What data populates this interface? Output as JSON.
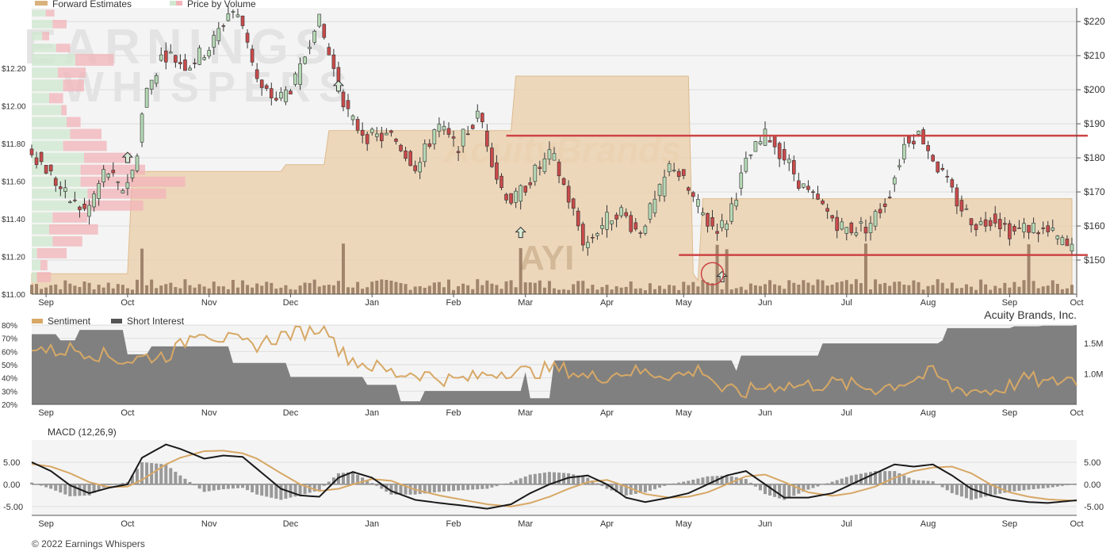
{
  "company": "Acuity Brands, Inc.",
  "ticker": "AYI",
  "watermark": [
    "EARNINGS",
    "WHISPERS"
  ],
  "watermark_logo": "AcuityBrands",
  "copyright": "© 2022 Earnings Whispers",
  "colors": {
    "up": "#b5d9b5",
    "down": "#c94a4a",
    "forward": "#d9b27c",
    "forward_fill": "#ecd2b2",
    "pv_up": "#cfe8cf",
    "pv_down": "#f2b3b8",
    "sentiment": "#d7a866",
    "short_interest": "#808080",
    "macd": "#1a1a1a",
    "signal": "#d7a866",
    "hist": "#999999",
    "resistance": "#cc4444",
    "grid": "#dddddd",
    "panel_bg": "#f4f4f4"
  },
  "chart_data": [
    {
      "type": "candlestick",
      "title": "",
      "legend": [
        "Forward Estimates",
        "Price by Volume"
      ],
      "months": [
        "Sep",
        "Oct",
        "Nov",
        "Dec",
        "Jan",
        "Feb",
        "Mar",
        "Apr",
        "May",
        "Jun",
        "Jul",
        "Aug",
        "Sep",
        "Oct"
      ],
      "y_right_ticks": [
        "$150",
        "$160",
        "$170",
        "$180",
        "$190",
        "$200",
        "$210",
        "$220"
      ],
      "y_right_range": [
        140,
        224
      ],
      "y_left_ticks": [
        "$11.00",
        "$11.20",
        "$11.40",
        "$11.60",
        "$11.80",
        "$12.00",
        "$12.20"
      ],
      "y_left_range": [
        11.0,
        12.52
      ],
      "price_path": [
        [
          0,
          183
        ],
        [
          4,
          176
        ],
        [
          8,
          168
        ],
        [
          12,
          164
        ],
        [
          16,
          177
        ],
        [
          19,
          170
        ],
        [
          22,
          177
        ],
        [
          24,
          198
        ],
        [
          28,
          211
        ],
        [
          33,
          207
        ],
        [
          38,
          213
        ],
        [
          42,
          224
        ],
        [
          45,
          218
        ],
        [
          48,
          200
        ],
        [
          52,
          197
        ],
        [
          56,
          203
        ],
        [
          60,
          222
        ],
        [
          63,
          208
        ],
        [
          67,
          191
        ],
        [
          71,
          186
        ],
        [
          76,
          186
        ],
        [
          81,
          177
        ],
        [
          85,
          190
        ],
        [
          89,
          183
        ],
        [
          94,
          193
        ],
        [
          98,
          172
        ],
        [
          101,
          167
        ],
        [
          105,
          175
        ],
        [
          109,
          181
        ],
        [
          112,
          170
        ],
        [
          116,
          154
        ],
        [
          119,
          160
        ],
        [
          123,
          165
        ],
        [
          127,
          158
        ],
        [
          131,
          168
        ],
        [
          134,
          179
        ],
        [
          138,
          169
        ],
        [
          142,
          160
        ],
        [
          145,
          160
        ],
        [
          150,
          180
        ],
        [
          154,
          187
        ],
        [
          158,
          179
        ],
        [
          162,
          170
        ],
        [
          165,
          166
        ],
        [
          170,
          159
        ],
        [
          175,
          160
        ],
        [
          179,
          168
        ],
        [
          183,
          186
        ],
        [
          186,
          187
        ],
        [
          190,
          176
        ],
        [
          194,
          166
        ],
        [
          198,
          160
        ],
        [
          201,
          163
        ],
        [
          205,
          158
        ],
        [
          209,
          160
        ],
        [
          214,
          157
        ],
        [
          217,
          153
        ]
      ],
      "forward_estimates": [
        [
          0,
          146
        ],
        [
          20,
          146
        ],
        [
          21,
          176
        ],
        [
          52,
          176
        ],
        [
          53,
          178
        ],
        [
          61,
          178
        ],
        [
          62,
          188
        ],
        [
          100,
          188
        ],
        [
          101,
          204
        ],
        [
          137,
          204
        ],
        [
          138,
          146
        ],
        [
          139,
          144
        ],
        [
          140,
          168
        ],
        [
          217,
          168
        ]
      ],
      "resistance_lines": [
        {
          "from": 99,
          "to": 217,
          "value": 186.5
        },
        {
          "from": 135,
          "to": 217,
          "value": 151.5
        }
      ],
      "price_by_volume": [
        {
          "price_low": 221.5,
          "price_high": 223.5,
          "up": 8,
          "down": 5
        },
        {
          "price_low": 218,
          "price_high": 220.5,
          "up": 12,
          "down": 8
        },
        {
          "price_low": 214.5,
          "price_high": 217,
          "up": 6,
          "down": 4
        },
        {
          "price_low": 211,
          "price_high": 213.5,
          "up": 14,
          "down": 8
        },
        {
          "price_low": 207,
          "price_high": 210.5,
          "up": 25,
          "down": 22
        },
        {
          "price_low": 203.5,
          "price_high": 206.5,
          "up": 15,
          "down": 16
        },
        {
          "price_low": 199.5,
          "price_high": 203,
          "up": 18,
          "down": 12
        },
        {
          "price_low": 196,
          "price_high": 199,
          "up": 10,
          "down": 8
        },
        {
          "price_low": 192.5,
          "price_high": 195.5,
          "up": 17,
          "down": 3
        },
        {
          "price_low": 189,
          "price_high": 192,
          "up": 20,
          "down": 8
        },
        {
          "price_low": 185.5,
          "price_high": 188.5,
          "up": 22,
          "down": 18
        },
        {
          "price_low": 182,
          "price_high": 185,
          "up": 18,
          "down": 25
        },
        {
          "price_low": 178.5,
          "price_high": 181.5,
          "up": 30,
          "down": 27
        },
        {
          "price_low": 175,
          "price_high": 178,
          "up": 28,
          "down": 37
        },
        {
          "price_low": 171.5,
          "price_high": 174.5,
          "up": 28,
          "down": 60
        },
        {
          "price_low": 168,
          "price_high": 171,
          "up": 32,
          "down": 45
        },
        {
          "price_low": 164.5,
          "price_high": 167.5,
          "up": 30,
          "down": 34
        },
        {
          "price_low": 161,
          "price_high": 164,
          "up": 12,
          "down": 20
        },
        {
          "price_low": 157.5,
          "price_high": 160.5,
          "up": 10,
          "down": 28
        },
        {
          "price_low": 154,
          "price_high": 157,
          "up": 12,
          "down": 17
        },
        {
          "price_low": 150.5,
          "price_high": 153.5,
          "up": 3,
          "down": 17
        },
        {
          "price_low": 147,
          "price_high": 150,
          "up": 5,
          "down": 4
        },
        {
          "price_low": 143.5,
          "price_high": 146.5,
          "up": 3,
          "down": 8
        }
      ],
      "markers": [
        {
          "day": 20,
          "price": 180,
          "direction": "up"
        },
        {
          "day": 64,
          "price": 201,
          "direction": "up"
        },
        {
          "day": 102,
          "price": 158,
          "direction": "up"
        },
        {
          "day": 144,
          "price": 145,
          "direction": "up"
        }
      ],
      "highlight_circle": {
        "day": 142,
        "price": 146
      }
    },
    {
      "type": "line+area",
      "legend": [
        "Sentiment",
        "Short Interest"
      ],
      "y_left_ticks": [
        "20%",
        "30%",
        "40%",
        "50%",
        "60%",
        "70%",
        "80%"
      ],
      "y_left_range": [
        20,
        80
      ],
      "y_right_ticks": [
        "1.0M",
        "1.5M"
      ],
      "y_right_range": [
        0.5,
        1.8
      ],
      "short_interest": [
        [
          0,
          1.65
        ],
        [
          6,
          1.55
        ],
        [
          10,
          1.72
        ],
        [
          20,
          1.32
        ],
        [
          25,
          1.45
        ],
        [
          41,
          1.45
        ],
        [
          42,
          1.18
        ],
        [
          53,
          1.18
        ],
        [
          54,
          0.95
        ],
        [
          70,
          0.82
        ],
        [
          77,
          0.55
        ],
        [
          82,
          0.72
        ],
        [
          103,
          1.03
        ],
        [
          104,
          0.6
        ],
        [
          109,
          1.22
        ],
        [
          147,
          1.05
        ],
        [
          148,
          1.3
        ],
        [
          165,
          1.5
        ],
        [
          190,
          1.55
        ],
        [
          191,
          1.75
        ],
        [
          205,
          1.78
        ],
        [
          211,
          1.79
        ],
        [
          218,
          1.8
        ]
      ],
      "sentiment": [
        [
          0,
          65
        ],
        [
          4,
          60
        ],
        [
          8,
          62
        ],
        [
          12,
          60
        ],
        [
          16,
          56
        ],
        [
          20,
          53
        ],
        [
          24,
          56
        ],
        [
          28,
          57
        ],
        [
          31,
          64
        ],
        [
          35,
          78
        ],
        [
          38,
          72
        ],
        [
          42,
          68
        ],
        [
          46,
          64
        ],
        [
          49,
          68
        ],
        [
          53,
          73
        ],
        [
          57,
          75
        ],
        [
          60,
          78
        ],
        [
          63,
          76
        ],
        [
          64,
          60
        ],
        [
          68,
          52
        ],
        [
          72,
          48
        ],
        [
          76,
          43
        ],
        [
          80,
          44
        ],
        [
          84,
          41
        ],
        [
          88,
          38
        ],
        [
          92,
          40
        ],
        [
          96,
          44
        ],
        [
          100,
          46
        ],
        [
          104,
          44
        ],
        [
          108,
          47
        ],
        [
          112,
          46
        ],
        [
          116,
          40
        ],
        [
          120,
          42
        ],
        [
          124,
          45
        ],
        [
          128,
          44
        ],
        [
          132,
          43
        ],
        [
          136,
          42
        ],
        [
          140,
          47
        ],
        [
          144,
          31
        ],
        [
          148,
          28
        ],
        [
          152,
          33
        ],
        [
          156,
          35
        ],
        [
          160,
          34
        ],
        [
          164,
          35
        ],
        [
          168,
          36
        ],
        [
          172,
          34
        ],
        [
          176,
          32
        ],
        [
          180,
          35
        ],
        [
          184,
          39
        ],
        [
          188,
          44
        ],
        [
          192,
          32
        ],
        [
          196,
          31
        ],
        [
          200,
          30
        ],
        [
          204,
          34
        ],
        [
          208,
          40
        ],
        [
          212,
          35
        ],
        [
          216,
          40
        ],
        [
          218,
          38
        ]
      ]
    },
    {
      "type": "line+histogram",
      "title": "MACD (12,26,9)",
      "y_ticks": [
        "-5.00",
        "0.00",
        "5.00"
      ],
      "y_range": [
        -7,
        10
      ],
      "macd": [
        [
          0,
          5
        ],
        [
          4,
          3
        ],
        [
          8,
          -0.2
        ],
        [
          12,
          -2
        ],
        [
          16,
          -0.8
        ],
        [
          20,
          0
        ],
        [
          23,
          6
        ],
        [
          28,
          9
        ],
        [
          31,
          8
        ],
        [
          36,
          5.8
        ],
        [
          40,
          6.5
        ],
        [
          44,
          6.2
        ],
        [
          47,
          3.5
        ],
        [
          52,
          -1
        ],
        [
          56,
          -2.5
        ],
        [
          60,
          -2.8
        ],
        [
          64,
          1.5
        ],
        [
          67,
          2.8
        ],
        [
          71,
          1.5
        ],
        [
          75,
          -1.5
        ],
        [
          80,
          -3.5
        ],
        [
          85,
          -4.2
        ],
        [
          90,
          -4.8
        ],
        [
          95,
          -5.5
        ],
        [
          100,
          -4.5
        ],
        [
          104,
          -2
        ],
        [
          108,
          0
        ],
        [
          112,
          1.5
        ],
        [
          116,
          2
        ],
        [
          120,
          0
        ],
        [
          124,
          -3
        ],
        [
          128,
          -4
        ],
        [
          133,
          -3
        ],
        [
          137,
          -2
        ],
        [
          141,
          0
        ],
        [
          145,
          2
        ],
        [
          149,
          3
        ],
        [
          153,
          0
        ],
        [
          157,
          -3
        ],
        [
          162,
          -3
        ],
        [
          167,
          -2
        ],
        [
          171,
          0
        ],
        [
          176,
          2.5
        ],
        [
          180,
          4.5
        ],
        [
          184,
          4
        ],
        [
          188,
          4.5
        ],
        [
          192,
          2
        ],
        [
          196,
          -1
        ],
        [
          200,
          -2.5
        ],
        [
          204,
          -3.5
        ],
        [
          208,
          -4
        ],
        [
          212,
          -4.2
        ],
        [
          216,
          -3.8
        ],
        [
          218,
          -3.6
        ]
      ],
      "signal": [
        [
          0,
          4.6
        ],
        [
          4,
          4
        ],
        [
          8,
          2.5
        ],
        [
          12,
          0.5
        ],
        [
          16,
          -0.6
        ],
        [
          20,
          -0.5
        ],
        [
          23,
          1
        ],
        [
          28,
          4.5
        ],
        [
          31,
          6
        ],
        [
          36,
          7.5
        ],
        [
          40,
          7.6
        ],
        [
          44,
          7
        ],
        [
          47,
          5.8
        ],
        [
          52,
          2.5
        ],
        [
          56,
          0
        ],
        [
          60,
          -1.5
        ],
        [
          64,
          -1
        ],
        [
          67,
          0
        ],
        [
          71,
          1.2
        ],
        [
          75,
          0.8
        ],
        [
          80,
          -1.2
        ],
        [
          85,
          -2.5
        ],
        [
          90,
          -3.5
        ],
        [
          95,
          -4.5
        ],
        [
          100,
          -5
        ],
        [
          104,
          -4.2
        ],
        [
          108,
          -2.8
        ],
        [
          112,
          -1
        ],
        [
          116,
          0.5
        ],
        [
          120,
          1
        ],
        [
          124,
          -0.5
        ],
        [
          128,
          -2.2
        ],
        [
          133,
          -3
        ],
        [
          137,
          -2.8
        ],
        [
          141,
          -1.8
        ],
        [
          145,
          0
        ],
        [
          149,
          1.8
        ],
        [
          153,
          2.2
        ],
        [
          157,
          0.5
        ],
        [
          162,
          -1.8
        ],
        [
          167,
          -2.6
        ],
        [
          171,
          -2
        ],
        [
          176,
          -0.5
        ],
        [
          180,
          1.5
        ],
        [
          184,
          3
        ],
        [
          188,
          3.8
        ],
        [
          192,
          4
        ],
        [
          196,
          2.5
        ],
        [
          200,
          0
        ],
        [
          204,
          -1.8
        ],
        [
          208,
          -2.8
        ],
        [
          212,
          -3.4
        ],
        [
          216,
          -3.6
        ],
        [
          218,
          -3.7
        ]
      ]
    }
  ]
}
